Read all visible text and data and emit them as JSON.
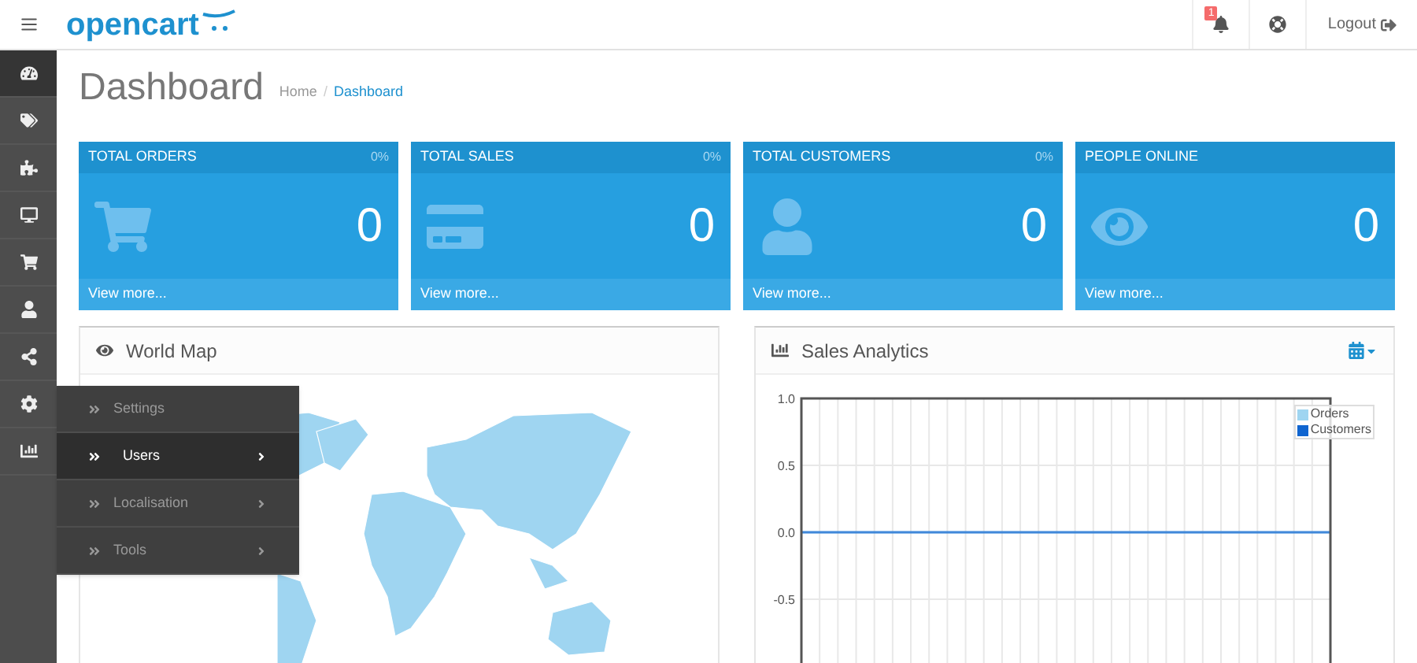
{
  "header": {
    "logo": "opencart",
    "notification_count": "1",
    "logout": "Logout"
  },
  "sidebar": {
    "items": [
      {
        "selected": true
      },
      {
        "selected": false
      },
      {
        "selected": false
      },
      {
        "selected": false
      },
      {
        "selected": false
      },
      {
        "selected": false
      },
      {
        "selected": false
      },
      {
        "selected": false
      },
      {
        "selected": false
      }
    ]
  },
  "flyout_menu": {
    "items": [
      {
        "label": "Settings",
        "selected": false,
        "has_children": false
      },
      {
        "label": "Users",
        "selected": true,
        "has_children": true
      },
      {
        "label": "Localisation",
        "selected": false,
        "has_children": true
      },
      {
        "label": "Tools",
        "selected": false,
        "has_children": true
      }
    ]
  },
  "page": {
    "title": "Dashboard",
    "breadcrumb_separator": "/",
    "breadcrumb": [
      {
        "label": "Home",
        "selected": false
      },
      {
        "label": "Dashboard",
        "selected": true
      }
    ]
  },
  "tiles": [
    {
      "title": "TOTAL ORDERS",
      "percent": "0%",
      "value": "0",
      "link": "View more..."
    },
    {
      "title": "TOTAL SALES",
      "percent": "0%",
      "value": "0",
      "link": "View more..."
    },
    {
      "title": "TOTAL CUSTOMERS",
      "percent": "0%",
      "value": "0",
      "link": "View more..."
    },
    {
      "title": "PEOPLE ONLINE",
      "value": "0",
      "link": "View more..."
    }
  ],
  "world_map": {
    "title": "World Map"
  },
  "sales_analytics": {
    "title": "Sales Analytics",
    "chart_data": {
      "type": "line",
      "grid": true,
      "legend": true,
      "ylim": [
        -1,
        1
      ],
      "yticks": [
        {
          "value": 1,
          "label": "1.0"
        },
        {
          "value": 0.5,
          "label": "0.5"
        },
        {
          "value": 0,
          "label": "0.0"
        },
        {
          "value": -0.5,
          "label": "-0.5"
        }
      ],
      "series": [
        {
          "name": "Orders",
          "color": "#9fd5f1",
          "values": [
            0,
            0,
            0,
            0,
            0,
            0,
            0,
            0,
            0,
            0,
            0,
            0,
            0,
            0,
            0,
            0,
            0,
            0,
            0,
            0,
            0,
            0,
            0,
            0,
            0,
            0,
            0,
            0,
            0,
            0
          ]
        },
        {
          "name": "Customers",
          "color": "#1065d0",
          "values": [
            0,
            0,
            0,
            0,
            0,
            0,
            0,
            0,
            0,
            0,
            0,
            0,
            0,
            0,
            0,
            0,
            0,
            0,
            0,
            0,
            0,
            0,
            0,
            0,
            0,
            0,
            0,
            0,
            0,
            0
          ]
        }
      ]
    }
  }
}
